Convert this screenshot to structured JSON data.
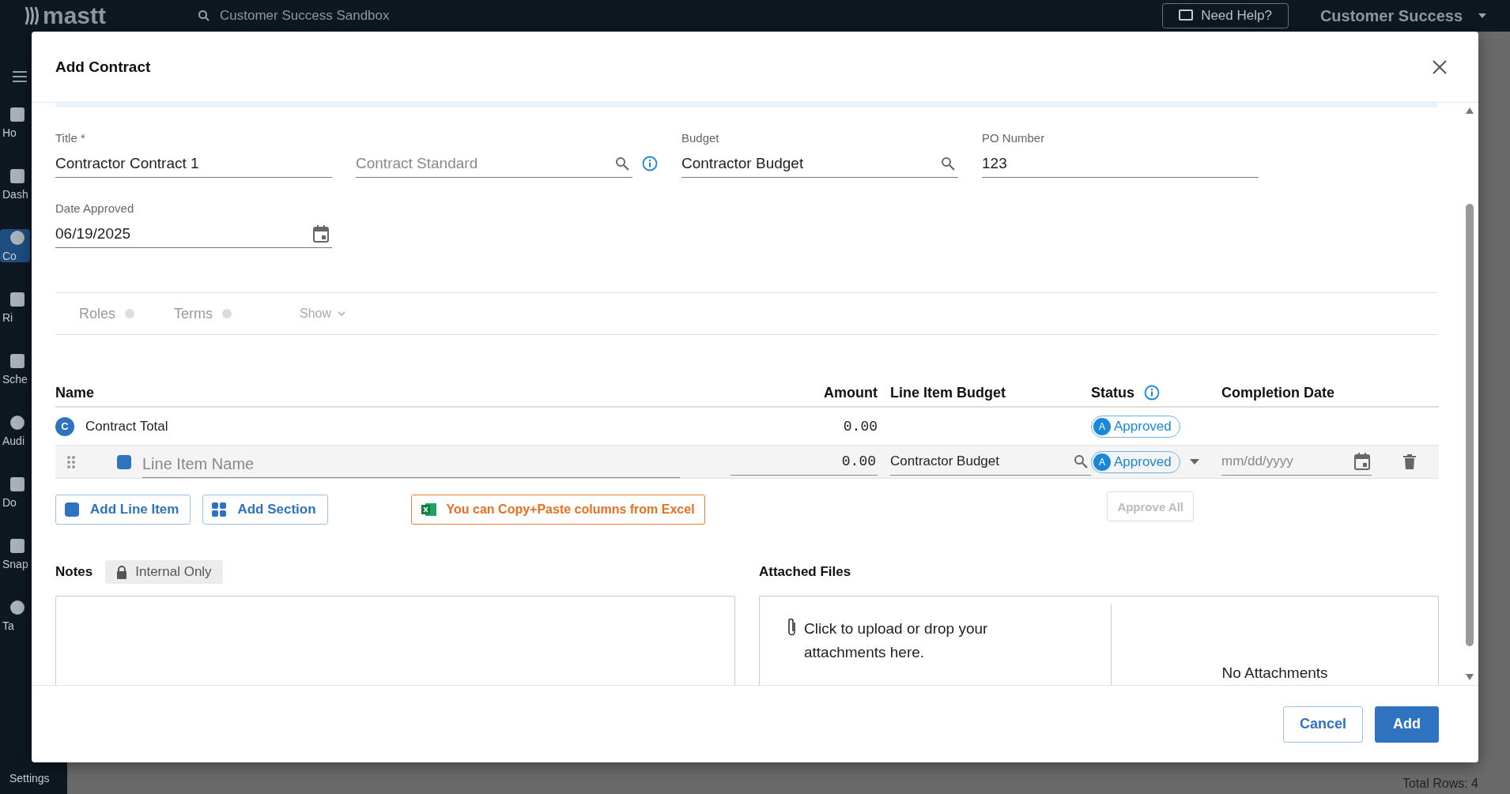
{
  "app": {
    "logo": "mastt",
    "search": "Customer Success Sandbox",
    "help_button": "Need Help?",
    "account": "Customer Success",
    "sidebar": [
      {
        "label": "Ho",
        "selected": false
      },
      {
        "label": "Dash",
        "selected": false
      },
      {
        "label": "Co",
        "selected": true
      },
      {
        "label": "Ri",
        "selected": false
      },
      {
        "label": "Sche",
        "selected": false
      },
      {
        "label": "Audi",
        "selected": false
      },
      {
        "label": "Do",
        "selected": false
      },
      {
        "label": "Snap",
        "selected": false
      },
      {
        "label": "Ta",
        "selected": false
      }
    ],
    "settings": "Settings",
    "footer_text": "Total Rows: 4"
  },
  "dialog": {
    "title": "Add Contract",
    "fields": [
      {
        "kind": "text",
        "label": "Title *",
        "value": "Contractor Contract 1"
      },
      {
        "kind": "lookup",
        "placeholder": "Contract Standard",
        "info": true
      },
      {
        "kind": "lookup",
        "label": "Budget",
        "value": "Contractor Budget"
      },
      {
        "kind": "text",
        "label": "PO Number",
        "value": "123"
      },
      {
        "kind": "date",
        "label": "Date Approved",
        "value": "06/19/2025"
      }
    ],
    "tabs": [
      {
        "label": "Roles",
        "selected": false
      },
      {
        "label": "Terms",
        "selected": false
      }
    ],
    "show_toggle": {
      "label": "Show",
      "expanded": false
    },
    "table": {
      "columns": [
        "Name",
        "Amount",
        "Line Item Budget",
        "Status",
        "Completion Date"
      ],
      "total_row": {
        "badge": "C",
        "name": "Contract Total",
        "amount": "0.00",
        "status_badge": "A",
        "status": "Approved"
      },
      "rows": [
        {
          "name_placeholder": "Line Item Name",
          "amount": "0.00",
          "budget": "Contractor Budget",
          "status_badge": "A",
          "status": "Approved",
          "date_placeholder": "mm/dd/yyyy"
        }
      ]
    },
    "actions": [
      {
        "label": "Add Line Item",
        "kind": "line"
      },
      {
        "label": "Add Section",
        "kind": "section"
      }
    ],
    "excel_hint": "You can Copy+Paste columns from Excel",
    "approve_all": {
      "label": "Approve All",
      "disabled": true
    },
    "notes": {
      "label": "Notes",
      "chip": "Internal Only"
    },
    "attachments": {
      "label": "Attached Files",
      "upload_text": "Click to upload or drop your attachments here.",
      "empty_text": "No Attachments"
    },
    "buttons": [
      {
        "label": "Cancel",
        "kind": "secondary"
      },
      {
        "label": "Add",
        "kind": "primary"
      }
    ]
  }
}
